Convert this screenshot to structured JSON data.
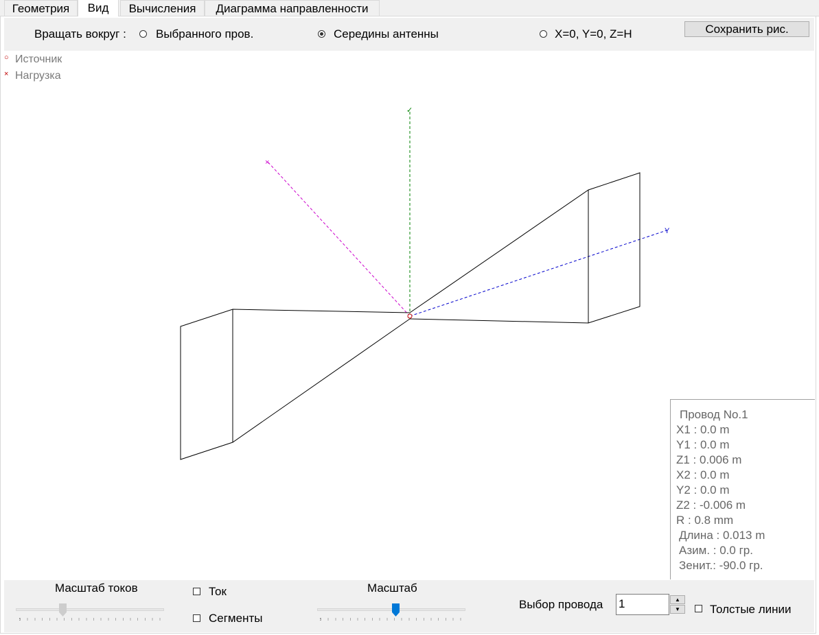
{
  "tabs": [
    {
      "label": "Геометрия"
    },
    {
      "label": "Вид"
    },
    {
      "label": "Вычисления"
    },
    {
      "label": "Диаграмма направленности"
    }
  ],
  "rotate": {
    "label": "Вращать вокруг :",
    "options": [
      {
        "label": "Выбранного пров.",
        "selected": false
      },
      {
        "label": "Середины антенны",
        "selected": true
      },
      {
        "label": "X=0, Y=0, Z=H",
        "selected": false
      }
    ]
  },
  "save_button": "Сохранить рис.",
  "legend": {
    "source": "Источник",
    "load": "Нагрузка"
  },
  "axes": {
    "x_color": "#cc00cc",
    "y_color": "#0000cc",
    "z_color": "#008000"
  },
  "wire_info": {
    "title": "Провод No.1",
    "x1": "X1   :  0.0 m",
    "y1": "Y1   :  0.0 m",
    "z1": "Z1   :  0.006 m",
    "x2": "X2   :  0.0 m",
    "y2": "Y2   :  0.0 m",
    "z2": "Z2   :  -0.006 m",
    "r": "R    :  0.8 mm",
    "length": "Длина  :  0.013 m",
    "azimuth": "Азим.   :  0.0 гр.",
    "zenith": "Зенит.:  -90.0 гр."
  },
  "bottom": {
    "current_scale_label": "Масштаб токов",
    "current_check": {
      "label": "Ток",
      "checked": false
    },
    "segments_check": {
      "label": "Сегменты",
      "checked": false
    },
    "scale_label": "Масштаб",
    "wire_select_label": "Выбор провода",
    "wire_select_value": "1",
    "thick_lines_check": {
      "label": "Толстые линии",
      "checked": false
    }
  }
}
